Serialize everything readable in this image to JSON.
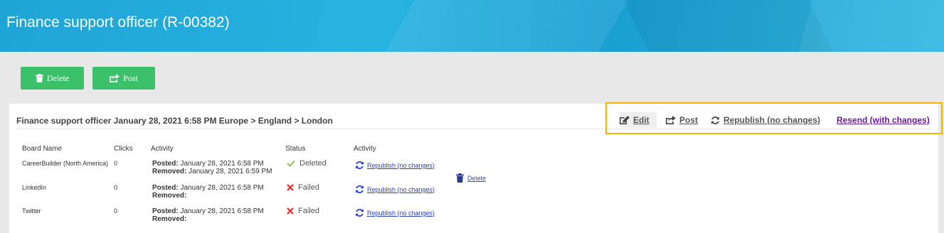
{
  "header": {
    "title": "Finance support officer (R-00382)"
  },
  "toolbar": {
    "delete_label": "Delete",
    "post_label": "Post"
  },
  "card": {
    "title": "Finance support officer January 28, 2021 6:58 PM Europe > England > London",
    "actions": {
      "edit": "Edit",
      "post": "Post",
      "republish": "Republish (no changes)",
      "resend": "Resend (with changes)"
    }
  },
  "table": {
    "headers": [
      "Board Name",
      "Clicks",
      "Activity",
      "Status",
      "Activity"
    ],
    "rows": [
      {
        "board": "CareerBuilder (North America)",
        "clicks": "0",
        "posted_label": "Posted:",
        "posted": "January 28, 2021 6:58 PM",
        "removed_label": "Removed:",
        "removed": "January 28, 2021 6:59 PM",
        "status": "Deleted",
        "status_icon": "check-icon",
        "action": "Republish (no changes)"
      },
      {
        "board": "LinkedIn",
        "clicks": "0",
        "posted_label": "Posted:",
        "posted": "January 28, 2021 6:58 PM",
        "removed_label": "Removed:",
        "removed": "",
        "status": "Failed",
        "status_icon": "x-icon",
        "action": "Republish (no changes)"
      },
      {
        "board": "Twitter",
        "clicks": "0",
        "posted_label": "Posted:",
        "posted": "January 28, 2021 6:58 PM",
        "removed_label": "Removed:",
        "removed": "",
        "status": "Failed",
        "status_icon": "x-icon",
        "action": "Republish (no changes)"
      }
    ],
    "delete_label": "Delete"
  },
  "colors": {
    "accent_green": "#3cc16b",
    "header_blue": "#27b3e0",
    "highlight": "#f5b400",
    "link_blue": "#2a3fbf",
    "purple": "#6a1b9a",
    "check": "#8bc34a",
    "fail": "#e53935"
  }
}
